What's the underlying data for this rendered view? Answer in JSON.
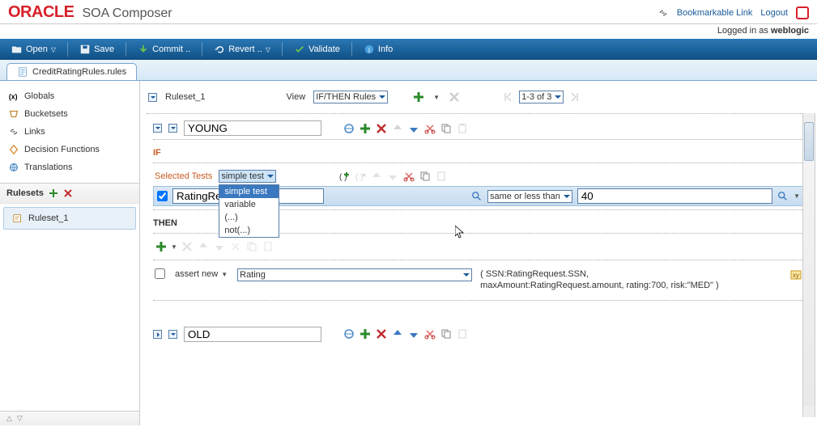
{
  "brand": {
    "oracle": "ORACLE",
    "composer": "SOA Composer"
  },
  "header_links": {
    "bookmarkable": "Bookmarkable Link",
    "logout": "Logout"
  },
  "logged_in": {
    "prefix": "Logged in as ",
    "user": "weblogic"
  },
  "toolbar": {
    "open": "Open",
    "save": "Save",
    "commit": "Commit ..",
    "revert": "Revert ..",
    "validate": "Validate",
    "info": "Info"
  },
  "tab": {
    "label": "CreditRatingRules.rules"
  },
  "sidebar": {
    "items": [
      {
        "icon": "globals-icon",
        "label": "Globals"
      },
      {
        "icon": "bucketsets-icon",
        "label": "Bucketsets"
      },
      {
        "icon": "links-icon",
        "label": "Links"
      },
      {
        "icon": "decision-functions-icon",
        "label": "Decision Functions"
      },
      {
        "icon": "translations-icon",
        "label": "Translations"
      }
    ],
    "rulesets_label": "Rulesets",
    "ruleset_item": "Ruleset_1"
  },
  "ruleset_bar": {
    "name": "Ruleset_1",
    "view_label": "View",
    "view_value": "IF/THEN Rules",
    "pager": "1-3 of 3"
  },
  "rule_young": {
    "name": "YOUNG",
    "if_label": "IF",
    "selected_tests_label": "Selected Tests",
    "test_type": "simple test",
    "dropdown_options": [
      "simple test",
      "variable",
      "(...)",
      "not(...)"
    ],
    "left_operand": "RatingRequ",
    "operator": "same or less than",
    "right_operand": "40",
    "then_label": "THEN",
    "assert_label": "assert new",
    "assert_value": "Rating",
    "props": "( SSN:RatingRequest.SSN, maxAmount:RatingRequest.amount, rating:700, risk:\"MED\" )"
  },
  "rule_old": {
    "name": "OLD"
  }
}
